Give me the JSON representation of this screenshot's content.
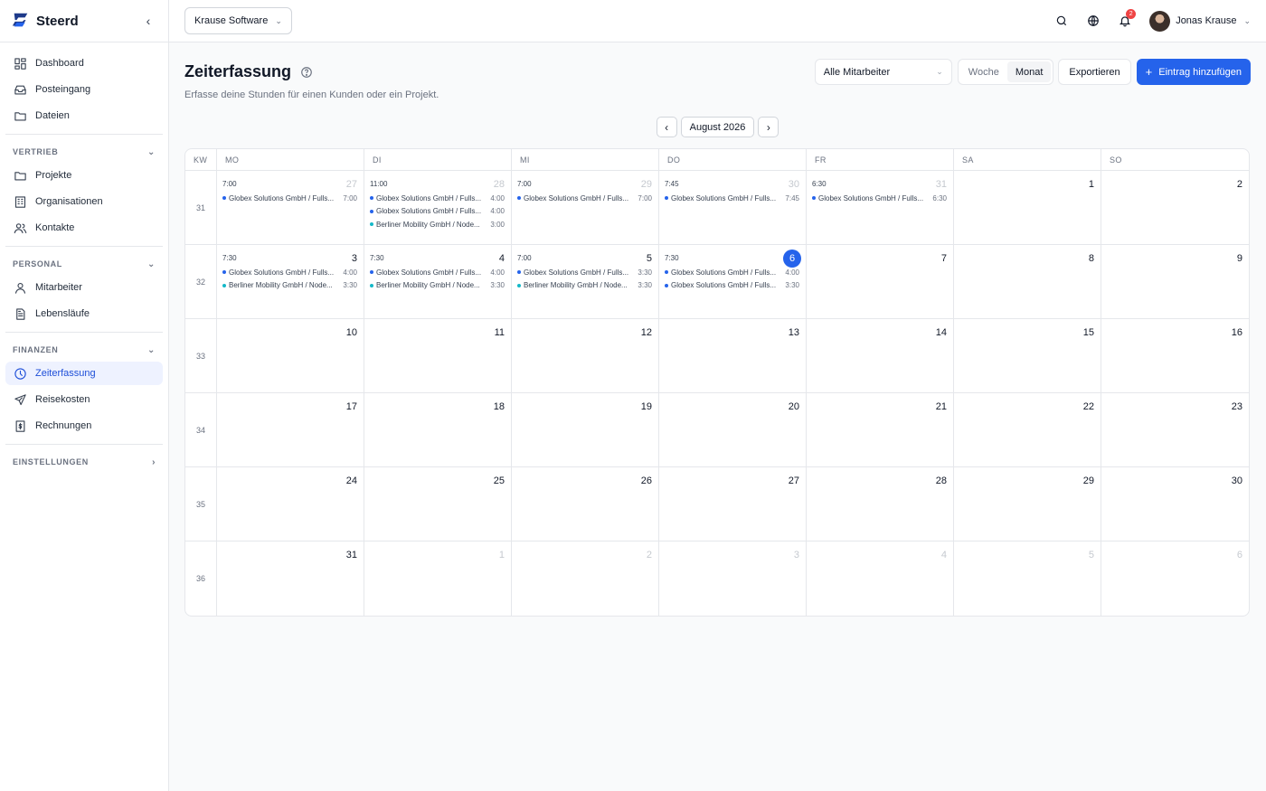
{
  "app": {
    "name": "Steerd"
  },
  "sidebar": {
    "top_items": [
      {
        "label": "Dashboard",
        "icon": "dashboard-icon"
      },
      {
        "label": "Posteingang",
        "icon": "inbox-icon"
      },
      {
        "label": "Dateien",
        "icon": "folder-icon"
      }
    ],
    "sections": [
      {
        "label": "VERTRIEB",
        "items": [
          {
            "label": "Projekte",
            "icon": "folder-icon"
          },
          {
            "label": "Organisationen",
            "icon": "building-icon"
          },
          {
            "label": "Kontakte",
            "icon": "users-icon"
          }
        ]
      },
      {
        "label": "PERSONAL",
        "items": [
          {
            "label": "Mitarbeiter",
            "icon": "user-icon"
          },
          {
            "label": "Lebensläufe",
            "icon": "document-icon"
          }
        ]
      },
      {
        "label": "FINANZEN",
        "items": [
          {
            "label": "Zeiterfassung",
            "icon": "clock-icon",
            "active": true
          },
          {
            "label": "Reisekosten",
            "icon": "plane-icon"
          },
          {
            "label": "Rechnungen",
            "icon": "invoice-icon"
          }
        ]
      }
    ],
    "settings_label": "EINSTELLUNGEN"
  },
  "topbar": {
    "org": "Krause Software",
    "notifications_count": "2",
    "user_name": "Jonas Krause"
  },
  "page": {
    "title": "Zeiterfassung",
    "subtitle": "Erfasse deine Stunden für einen Kunden oder ein Projekt.",
    "employee_filter": "Alle Mitarbeiter",
    "view_week": "Woche",
    "view_month": "Monat",
    "export_label": "Exportieren",
    "add_label": "Eintrag hinzufügen",
    "month_label": "August 2026"
  },
  "colors": {
    "accent": "#2563eb",
    "globex": "#2563eb",
    "berliner": "#14b8c8"
  },
  "calendar": {
    "headers": [
      "KW",
      "MO",
      "DI",
      "MI",
      "DO",
      "FR",
      "SA",
      "SO"
    ],
    "weeks": [
      {
        "kw": "31",
        "days": [
          {
            "day": "27",
            "muted": true,
            "total": "7:00",
            "entries": [
              {
                "label": "Globex Solutions GmbH / Fulls...",
                "hours": "7:00",
                "client": "globex"
              }
            ]
          },
          {
            "day": "28",
            "muted": true,
            "total": "11:00",
            "entries": [
              {
                "label": "Globex Solutions GmbH / Fulls...",
                "hours": "4:00",
                "client": "globex"
              },
              {
                "label": "Globex Solutions GmbH / Fulls...",
                "hours": "4:00",
                "client": "globex"
              },
              {
                "label": "Berliner Mobility GmbH / Node...",
                "hours": "3:00",
                "client": "berliner"
              }
            ]
          },
          {
            "day": "29",
            "muted": true,
            "total": "7:00",
            "entries": [
              {
                "label": "Globex Solutions GmbH / Fulls...",
                "hours": "7:00",
                "client": "globex"
              }
            ]
          },
          {
            "day": "30",
            "muted": true,
            "total": "7:45",
            "entries": [
              {
                "label": "Globex Solutions GmbH / Fulls...",
                "hours": "7:45",
                "client": "globex"
              }
            ]
          },
          {
            "day": "31",
            "muted": true,
            "total": "6:30",
            "entries": [
              {
                "label": "Globex Solutions GmbH / Fulls...",
                "hours": "6:30",
                "client": "globex"
              }
            ]
          },
          {
            "day": "1",
            "entries": []
          },
          {
            "day": "2",
            "entries": []
          }
        ]
      },
      {
        "kw": "32",
        "days": [
          {
            "day": "3",
            "total": "7:30",
            "entries": [
              {
                "label": "Globex Solutions GmbH / Fulls...",
                "hours": "4:00",
                "client": "globex"
              },
              {
                "label": "Berliner Mobility GmbH / Node...",
                "hours": "3:30",
                "client": "berliner"
              }
            ]
          },
          {
            "day": "4",
            "total": "7:30",
            "entries": [
              {
                "label": "Globex Solutions GmbH / Fulls...",
                "hours": "4:00",
                "client": "globex"
              },
              {
                "label": "Berliner Mobility GmbH / Node...",
                "hours": "3:30",
                "client": "berliner"
              }
            ]
          },
          {
            "day": "5",
            "total": "7:00",
            "entries": [
              {
                "label": "Globex Solutions GmbH / Fulls...",
                "hours": "3:30",
                "client": "globex"
              },
              {
                "label": "Berliner Mobility GmbH / Node...",
                "hours": "3:30",
                "client": "berliner"
              }
            ]
          },
          {
            "day": "6",
            "today": true,
            "total": "7:30",
            "entries": [
              {
                "label": "Globex Solutions GmbH / Fulls...",
                "hours": "4:00",
                "client": "globex"
              },
              {
                "label": "Globex Solutions GmbH / Fulls...",
                "hours": "3:30",
                "client": "globex"
              }
            ]
          },
          {
            "day": "7",
            "entries": []
          },
          {
            "day": "8",
            "entries": []
          },
          {
            "day": "9",
            "entries": []
          }
        ]
      },
      {
        "kw": "33",
        "days": [
          {
            "day": "10",
            "entries": []
          },
          {
            "day": "11",
            "entries": []
          },
          {
            "day": "12",
            "entries": []
          },
          {
            "day": "13",
            "entries": []
          },
          {
            "day": "14",
            "entries": []
          },
          {
            "day": "15",
            "entries": []
          },
          {
            "day": "16",
            "entries": []
          }
        ]
      },
      {
        "kw": "34",
        "days": [
          {
            "day": "17",
            "entries": []
          },
          {
            "day": "18",
            "entries": []
          },
          {
            "day": "19",
            "entries": []
          },
          {
            "day": "20",
            "entries": []
          },
          {
            "day": "21",
            "entries": []
          },
          {
            "day": "22",
            "entries": []
          },
          {
            "day": "23",
            "entries": []
          }
        ]
      },
      {
        "kw": "35",
        "days": [
          {
            "day": "24",
            "entries": []
          },
          {
            "day": "25",
            "entries": []
          },
          {
            "day": "26",
            "entries": []
          },
          {
            "day": "27",
            "entries": []
          },
          {
            "day": "28",
            "entries": []
          },
          {
            "day": "29",
            "entries": []
          },
          {
            "day": "30",
            "entries": []
          }
        ]
      },
      {
        "kw": "36",
        "days": [
          {
            "day": "31",
            "entries": []
          },
          {
            "day": "1",
            "muted": true,
            "entries": []
          },
          {
            "day": "2",
            "muted": true,
            "entries": []
          },
          {
            "day": "3",
            "muted": true,
            "entries": []
          },
          {
            "day": "4",
            "muted": true,
            "entries": []
          },
          {
            "day": "5",
            "muted": true,
            "entries": []
          },
          {
            "day": "6",
            "muted": true,
            "entries": []
          }
        ]
      }
    ]
  }
}
